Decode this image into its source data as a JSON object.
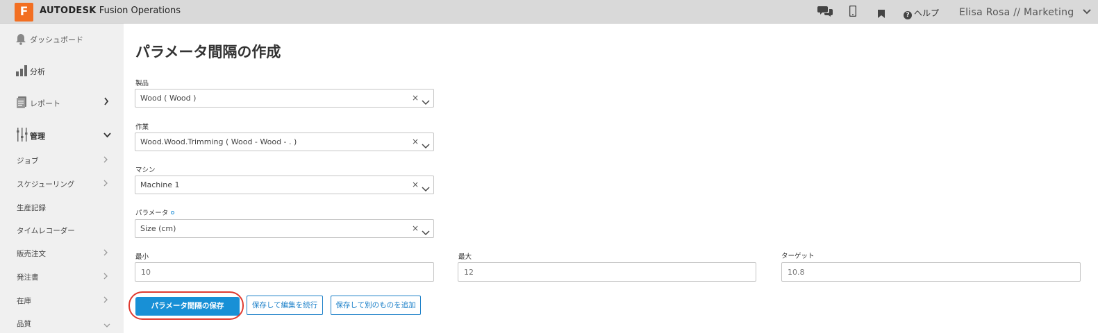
{
  "header": {
    "logo_letter": "F",
    "brand_bold": "AUTODESK",
    "brand_rest": "Fusion Operations",
    "help_label": "ヘルプ",
    "user_label": "Elisa Rosa // Marketing"
  },
  "sidebar": {
    "items": [
      {
        "label": "ダッシュボード"
      },
      {
        "label": "分析"
      },
      {
        "label": "レポート"
      },
      {
        "label": "管理"
      },
      {
        "label": "ジョブ"
      },
      {
        "label": "スケジューリング"
      },
      {
        "label": "生産記録"
      },
      {
        "label": "タイムレコーダー"
      },
      {
        "label": "販売注文"
      },
      {
        "label": "発注書"
      },
      {
        "label": "在庫"
      },
      {
        "label": "品質"
      }
    ]
  },
  "form": {
    "title": "パラメータ間隔の作成",
    "product": {
      "label": "製品",
      "value": "Wood ( Wood )"
    },
    "operation": {
      "label": "作業",
      "value": "Wood.Wood.Trimming ( Wood - Wood - . )"
    },
    "machine": {
      "label": "マシン",
      "value": "Machine 1"
    },
    "parameter": {
      "label": "パラメータ",
      "value": "Size (cm)"
    },
    "min": {
      "label": "最小",
      "value": "10"
    },
    "max": {
      "label": "最大",
      "value": "12"
    },
    "target": {
      "label": "ターゲット",
      "value": "10.8"
    },
    "buttons": {
      "save": "パラメータ間隔の保存",
      "save_continue": "保存して編集を続行",
      "save_add": "保存して別のものを追加"
    }
  },
  "colors": {
    "accent": "#1890d6",
    "logo": "#f26f22",
    "highlight": "#e03a2f"
  }
}
